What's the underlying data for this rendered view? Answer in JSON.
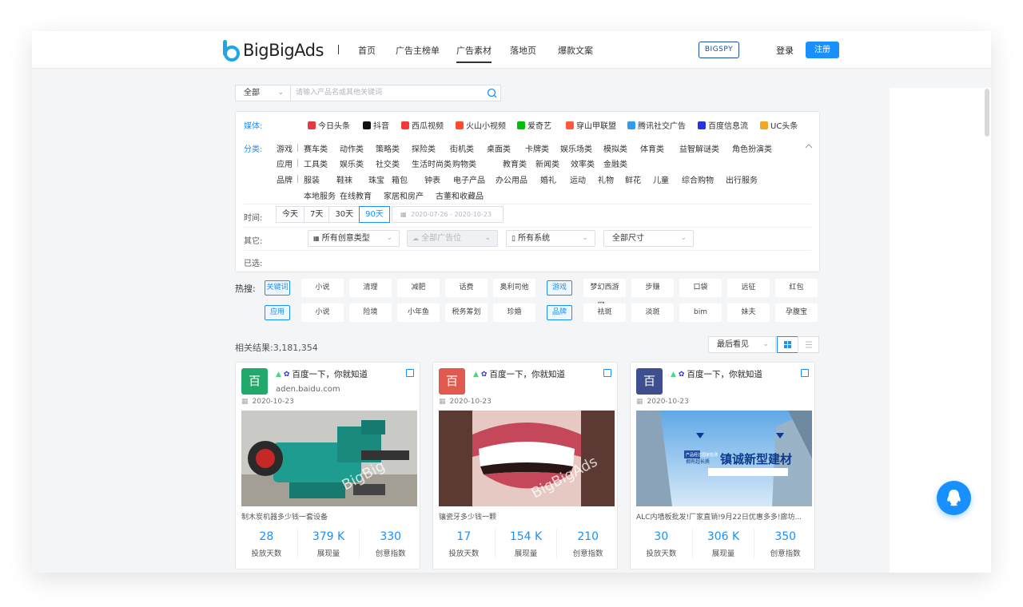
{
  "brand": {
    "name": "BigBigAds",
    "color": "#1890ff"
  },
  "nav": {
    "items": [
      "首页",
      "广告主榜单",
      "广告素材",
      "落地页",
      "爆款文案"
    ],
    "active": "广告素材"
  },
  "header": {
    "bigspy": "BIGSPY",
    "login": "登录",
    "register": "注册"
  },
  "search": {
    "scope": "全部",
    "placeholder": "请输入产品名或其他关键词"
  },
  "filters": {
    "media_label": "媒体:",
    "media": [
      {
        "label": "今日头条",
        "color": "#e6393f"
      },
      {
        "label": "抖音",
        "color": "#111111"
      },
      {
        "label": "西瓜视频",
        "color": "#f5383a"
      },
      {
        "label": "火山小视频",
        "color": "#ff4b2b"
      },
      {
        "label": "爱奇艺",
        "color": "#00be06"
      },
      {
        "label": "穿山甲联盟",
        "color": "#ff5a3c"
      },
      {
        "label": "腾讯社交广告",
        "color": "#2f9df3"
      },
      {
        "label": "百度信息流",
        "color": "#2932e1"
      },
      {
        "label": "UC头条",
        "color": "#f2a724"
      }
    ],
    "category_label": "分类:",
    "categories": [
      {
        "group": "游戏",
        "items": [
          "赛车类",
          "动作类",
          "策略类",
          "探险类",
          "街机类",
          "桌面类",
          "卡牌类",
          "娱乐场类",
          "模拟类",
          "体育类",
          "益智解谜类",
          "角色扮演类"
        ]
      },
      {
        "group": "应用",
        "items": [
          "工具类",
          "娱乐类",
          "社交类",
          "生活时尚类",
          "购物类",
          "教育类",
          "新闻类",
          "效率类",
          "金融类"
        ]
      },
      {
        "group": "品牌",
        "items": [
          "服装",
          "鞋袜",
          "珠宝",
          "箱包",
          "钟表",
          "电子产品",
          "办公用品",
          "婚礼",
          "运动",
          "礼物",
          "鲜花",
          "儿童",
          "综合购物",
          "出行服务",
          "本地服务",
          "在线教育",
          "家居和房产",
          "古董和收藏品"
        ]
      }
    ],
    "time_label": "时间:",
    "time_options": [
      "今天",
      "7天",
      "30天",
      "90天"
    ],
    "time_active": "90天",
    "date_range": "2020-07-26 - 2020-10-23",
    "other_label": "其它:",
    "creative_type": "所有创意类型",
    "ad_position": "全部广告位",
    "system": "所有系统",
    "size": "全部尺寸",
    "selected_label": "已选:"
  },
  "hot": {
    "label": "热搜:",
    "row1": [
      {
        "text": "关键词",
        "tag": true
      },
      {
        "text": "小说"
      },
      {
        "text": "清理"
      },
      {
        "text": "减肥"
      },
      {
        "text": "话费"
      },
      {
        "text": "奥利司他"
      },
      {
        "text": "游戏",
        "tag": true
      },
      {
        "text": "梦幻西游网..."
      },
      {
        "text": "步赚"
      },
      {
        "text": "口袋"
      },
      {
        "text": "远征"
      },
      {
        "text": "红包"
      }
    ],
    "row2": [
      {
        "text": "应用",
        "tag": true
      },
      {
        "text": "小说"
      },
      {
        "text": "险境"
      },
      {
        "text": "小年鱼"
      },
      {
        "text": "税务筹划"
      },
      {
        "text": "珍婚"
      },
      {
        "text": "品牌",
        "tag": true
      },
      {
        "text": "祛斑"
      },
      {
        "text": "淡斑"
      },
      {
        "text": "bim"
      },
      {
        "text": "妹夫"
      },
      {
        "text": "孕腹宝"
      }
    ]
  },
  "results": {
    "label": "相关结果:3,181,354",
    "sort": "最后看见"
  },
  "cards": [
    {
      "badge": "百",
      "badge_color": "#21a96b",
      "title": "百度一下，你就知道",
      "domain": "aden.baidu.com",
      "date": "2020-10-23",
      "desc": "制木炭机器多少钱一套设备",
      "stats": [
        {
          "value": "28",
          "label": "投放天数"
        },
        {
          "value": "379 K",
          "label": "展现量"
        },
        {
          "value": "330",
          "label": "创意指数"
        }
      ],
      "watermark": "BigBig"
    },
    {
      "badge": "百",
      "badge_color": "#e05a4e",
      "title": "百度一下，你就知道",
      "domain": "",
      "date": "2020-10-23",
      "desc": "镶瓷牙多少钱一颗",
      "stats": [
        {
          "value": "17",
          "label": "投放天数"
        },
        {
          "value": "154 K",
          "label": "展现量"
        },
        {
          "value": "210",
          "label": "创意指数"
        }
      ],
      "watermark": "BigBigAds"
    },
    {
      "badge": "百",
      "badge_color": "#3d4f8f",
      "title": "百度一下，你就知道",
      "domain": "",
      "date": "2020-10-23",
      "desc": "ALC内墙板批发!厂家直销!9月22日优惠多多!廊坊...",
      "stats": [
        {
          "value": "30",
          "label": "投放天数"
        },
        {
          "value": "306 K",
          "label": "展现量"
        },
        {
          "value": "350",
          "label": "创意指数"
        }
      ],
      "banner_title": "镇诚新型建材",
      "banner_small": "拥有超长质",
      "banner_tag": "产品经过国家检测"
    }
  ]
}
